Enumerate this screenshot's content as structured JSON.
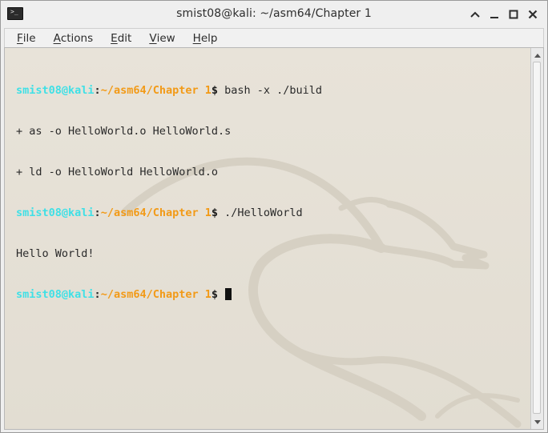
{
  "window": {
    "title": "smist08@kali: ~/asm64/Chapter 1",
    "app_icon": "terminal-icon",
    "buttons": [
      "maximize-icon",
      "minimize-icon",
      "restore-icon",
      "close-icon"
    ]
  },
  "menubar": {
    "items": [
      {
        "mnemonic": "F",
        "rest": "ile"
      },
      {
        "mnemonic": "A",
        "rest": "ctions"
      },
      {
        "mnemonic": "E",
        "rest": "dit"
      },
      {
        "mnemonic": "V",
        "rest": "iew"
      },
      {
        "mnemonic": "H",
        "rest": "elp"
      }
    ]
  },
  "terminal": {
    "colors": {
      "user": "#3fe0e6",
      "path": "#f29a17",
      "background": "#e5e0d6",
      "text": "#2a2a2a"
    },
    "prompt": {
      "user_host": "smist08@kali",
      "colon": ":",
      "path": "~/asm64/Chapter 1",
      "dollar": "$"
    },
    "lines": [
      {
        "type": "prompt",
        "command": " bash -x ./build"
      },
      {
        "type": "output",
        "text": "+ as -o HelloWorld.o HelloWorld.s"
      },
      {
        "type": "output",
        "text": "+ ld -o HelloWorld HelloWorld.o"
      },
      {
        "type": "prompt",
        "command": " ./HelloWorld"
      },
      {
        "type": "output",
        "text": "Hello World!"
      },
      {
        "type": "prompt",
        "command": " "
      }
    ]
  },
  "scrollbar": {
    "up_icon": "scroll-up-arrow-icon",
    "down_icon": "scroll-down-arrow-icon"
  }
}
